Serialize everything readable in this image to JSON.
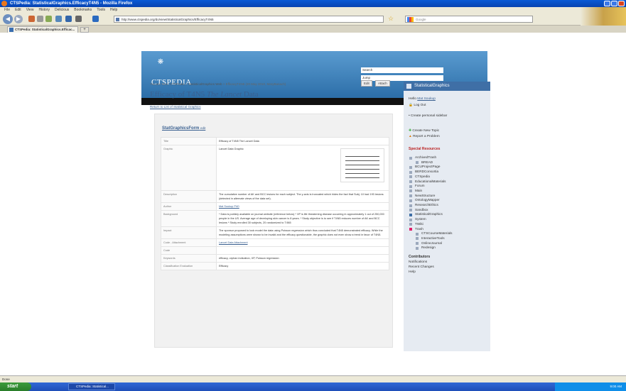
{
  "window": {
    "title": "CTSPedia: StatisticalGraphics.EfficacyT4N5 - Mozilla Firefox"
  },
  "menu": [
    "File",
    "Edit",
    "View",
    "History",
    "Delicious",
    "Bookmarks",
    "Tools",
    "Help"
  ],
  "nav": {
    "url": "http://www.ctspedia.org/do/view/StatisticalGraphics/EfficacyT4N5",
    "search_placeholder": "Google"
  },
  "tab": {
    "label": "CTSPedia: StatisticalGraphics.Efficac...",
    "new_tab": "+"
  },
  "site": {
    "logo": "CTSPEDIA",
    "search_label": "Search",
    "jump_label": "Jump"
  },
  "page": {
    "breadcrumb_prefix": "You are here:",
    "breadcrumb": [
      "CTSPedia",
      "StatisticalGraphics Web",
      "EfficacyT4N5 (20 May 2010, MaryBanach)"
    ],
    "edit_label": "Edit",
    "attach_label": "Attach",
    "title_prefix": "Efficacy of T4N5",
    "title_italic": "The Lancet",
    "title_suffix": "Data",
    "back_link": "Return to List of Statistical Graphics",
    "form_name": "StatGraphicsForm",
    "form_edit": "edit"
  },
  "form_rows": [
    {
      "key": "Title",
      "value": "Efficacy of T4N5 The Lancet Data"
    },
    {
      "key": "Graphic",
      "value": "Lancet Data Graphic"
    },
    {
      "key": "Description",
      "value": "The cumulative number of AK and BCC lesions for each subject. The y-axis is truncated which hides the fact that Subj. 10 had 193 lesions (detected in alternate views of the data set)."
    },
    {
      "key": "Author",
      "value": "Mat Soukup PhD"
    },
    {
      "key": "Background",
      "value": "* Data is publicly available on journal website (reference below) * XP is life threatening disease occurring in approximately 1 out of 250,000 people in the US. Average age of developing skin cancer is 8 years. * Study objective is to see if T4N5 reduces number of AK and BCC lesions * Study enrolled 30 subjects, 20 randomized to T4N5"
    },
    {
      "key": "Impact",
      "value": "The sponsor proposed to look model the data using Poisson regression which thus concluded that T4N5 demonstrated efficacy. While the modeling assumptions were shown to be invalid and the efficacy questionable, the graphic does not even show a trend in favor of T4N5."
    },
    {
      "key": "Code - Attachment",
      "value": "Lancet Data Attachment"
    },
    {
      "key": "Code",
      "value": ""
    },
    {
      "key": "Keywords",
      "value": "efficacy, orphan indication, XP, Poisson regression"
    },
    {
      "key": "Classification Evaluation",
      "value": "Efficacy"
    }
  ],
  "sidebar": {
    "web_name": "StatisticalGraphics",
    "hello": "Hello",
    "user": "Mat Soukup",
    "logout": "Log Out",
    "create_sidebar": "Create personal sidebar",
    "create_topic": "Create New Topic",
    "report_problem": "Report a Problem",
    "special_resources": "Special Resources",
    "webs": [
      {
        "label": "ArchivedTrash",
        "sub": false
      },
      {
        "label": "BREAD",
        "sub": true
      },
      {
        "label": "BCUProjectPage",
        "sub": false
      },
      {
        "label": "BERDConsortia",
        "sub": false
      },
      {
        "label": "CTSpedia",
        "sub": false
      },
      {
        "label": "EducationalMaterials",
        "sub": false
      },
      {
        "label": "Forum",
        "sub": false
      },
      {
        "label": "Main",
        "sub": false
      },
      {
        "label": "NewStructure",
        "sub": false
      },
      {
        "label": "OntologyMapper",
        "sub": false
      },
      {
        "label": "ResearchEthics",
        "sub": false
      },
      {
        "label": "Sandbox",
        "sub": false
      },
      {
        "label": "StatisticalGraphics",
        "sub": false
      },
      {
        "label": "System",
        "sub": false
      },
      {
        "label": "TWiki",
        "sub": false
      },
      {
        "label": "Trash",
        "sub": false
      },
      {
        "label": "CTSCourseMaterials",
        "sub": true
      },
      {
        "label": "InteractiveTools",
        "sub": true
      },
      {
        "label": "OnlineJournal",
        "sub": true
      },
      {
        "label": "Redesign",
        "sub": true
      }
    ],
    "contributors": "Contributors",
    "links": [
      "Notifications",
      "Recent Changes",
      "Help"
    ]
  },
  "status": {
    "text": "Done"
  },
  "taskbar": {
    "start": "start",
    "task": "CTSPedia: Statistical...",
    "clock": "9:00 AM"
  },
  "colors": {
    "accent": "#3f6fa6",
    "header_top": "#5a9bd0",
    "header_bottom": "#2c6ea8"
  }
}
